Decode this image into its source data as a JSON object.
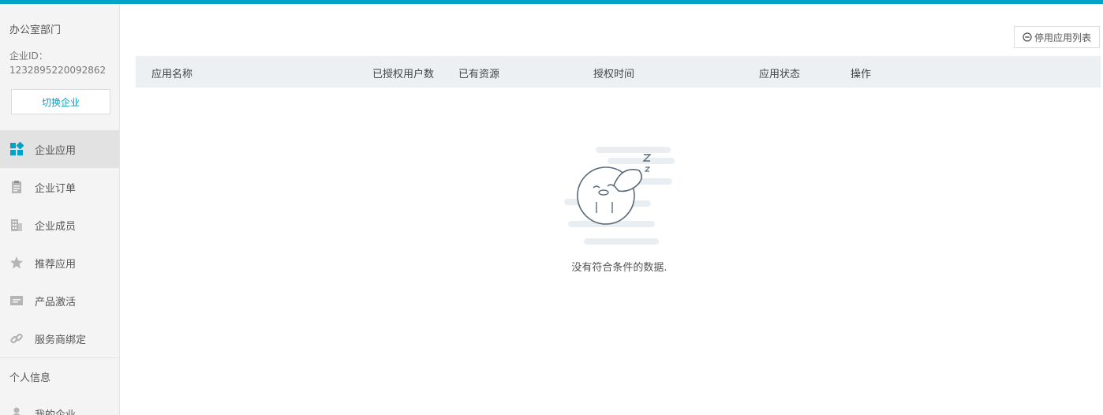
{
  "sidebar": {
    "dept": "办公室部门",
    "enterprise_id_label": "企业ID：",
    "enterprise_id": "1232895220092862",
    "switch_label": "切换企业",
    "items": [
      {
        "label": "企业应用",
        "icon": "grid-icon",
        "active": true
      },
      {
        "label": "企业订单",
        "icon": "clipboard-icon"
      },
      {
        "label": "企业成员",
        "icon": "building-icon"
      },
      {
        "label": "推荐应用",
        "icon": "star-icon"
      },
      {
        "label": "产品激活",
        "icon": "ticket-icon"
      },
      {
        "label": "服务商绑定",
        "icon": "link-icon"
      }
    ],
    "section_personal": "个人信息",
    "personal_items": [
      {
        "label": "我的企业",
        "icon": "person-icon"
      }
    ]
  },
  "toolbar": {
    "disabled_apps_label": "停用应用列表"
  },
  "table": {
    "columns": [
      "应用名称",
      "已授权用户数",
      "已有资源",
      "授权时间",
      "应用状态",
      "操作"
    ]
  },
  "empty_state": {
    "message": "没有符合条件的数据."
  },
  "colors": {
    "accent": "#00a2ca",
    "sidebar_bg": "#f4f4f4",
    "header_bg": "#edf0f3"
  }
}
